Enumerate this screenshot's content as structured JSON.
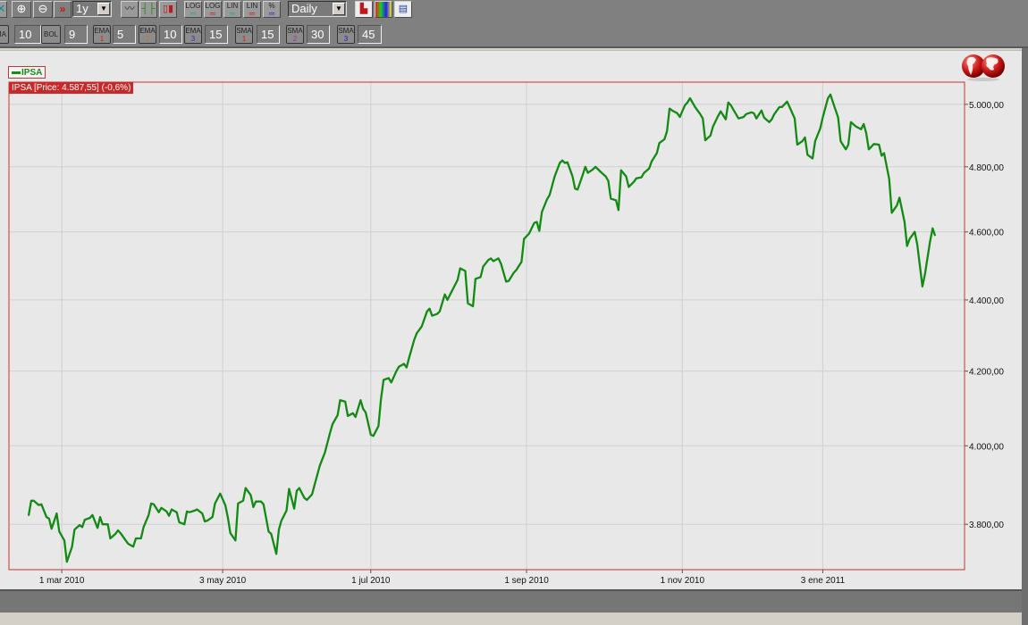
{
  "toolbar": {
    "period_select": "1y",
    "interval_select": "Daily",
    "scale_buttons": [
      {
        "top": "LOG",
        "color": "#3aa36a"
      },
      {
        "top": "LOG",
        "color": "#d02020"
      },
      {
        "top": "LIN",
        "color": "#3aa36a"
      },
      {
        "top": "LIN",
        "color": "#d02020"
      },
      {
        "top": "%",
        "color": "#3030c0"
      }
    ],
    "icons": [
      "close-icon",
      "zoom-in-icon",
      "zoom-out-icon",
      "double-chevron-right-icon",
      "line-chart-icon",
      "ohlc-chart-icon",
      "candlestick-chart-icon",
      "chart-settings-icon",
      "color-palette-icon",
      "report-icon"
    ]
  },
  "indicators": [
    {
      "label": "MA",
      "sub": "",
      "sub_color": "",
      "value": "10"
    },
    {
      "label": "BOL",
      "sub": "",
      "sub_color": "",
      "value": "9"
    },
    {
      "label": "EMA",
      "sub": "1",
      "sub_color": "#d02020",
      "value": "5"
    },
    {
      "label": "EMA",
      "sub": "2",
      "sub_color": "#d07020",
      "value": "10"
    },
    {
      "label": "EMA",
      "sub": "3",
      "sub_color": "#3030c0",
      "value": "15"
    },
    {
      "label": "SMA",
      "sub": "1",
      "sub_color": "#d02020",
      "value": "15"
    },
    {
      "label": "SMA",
      "sub": "2",
      "sub_color": "#a030a0",
      "value": "30"
    },
    {
      "label": "SMA",
      "sub": "3",
      "sub_color": "#2020c0",
      "value": "45"
    }
  ],
  "legend": {
    "label": "IPSA",
    "color": "#1a8a1a"
  },
  "price_tag": "IPSA [Price: 4.587,55] (-0,6%)",
  "colors": {
    "line": "#138a13",
    "frame": "#c83030",
    "grid": "#d0d0d0",
    "panel": "#e8e8e8"
  },
  "chart_data": {
    "type": "line",
    "title": "IPSA",
    "yscale": "log",
    "ylim": [
      3689,
      5073
    ],
    "xlim": [
      -20.7,
      353.5
    ],
    "x_unit": "days from 1 mar 2010 (axis)",
    "y_ticks": [
      {
        "v": 3800,
        "label": "3.800,00"
      },
      {
        "v": 4000,
        "label": "4.000,00"
      },
      {
        "v": 4200,
        "label": "4.200,00"
      },
      {
        "v": 4400,
        "label": "4.400,00"
      },
      {
        "v": 4600,
        "label": "4.600,00"
      },
      {
        "v": 4800,
        "label": "4.800,00"
      },
      {
        "v": 5000,
        "label": "5.000,00"
      }
    ],
    "x_ticks": [
      {
        "v": 0,
        "label": "1 mar 2010"
      },
      {
        "v": 63,
        "label": "3 may 2010"
      },
      {
        "v": 121,
        "label": "1 jul 2010"
      },
      {
        "v": 182,
        "label": "1 sep 2010"
      },
      {
        "v": 243,
        "label": "1 nov 2010"
      },
      {
        "v": 298,
        "label": "3 ene 2011"
      }
    ],
    "grid": true,
    "series": [
      {
        "name": "IPSA",
        "x": [
          -13,
          -12,
          -11,
          -9,
          -8,
          -6,
          -5,
          -4,
          -2,
          -1,
          1,
          2,
          4,
          5,
          7,
          8,
          9,
          11,
          12,
          14,
          15,
          16,
          18,
          19,
          21,
          22,
          23,
          25,
          26,
          28,
          29,
          31,
          32,
          34,
          35,
          36,
          38,
          39,
          41,
          42,
          43,
          45,
          46,
          48,
          49,
          50,
          52,
          53,
          55,
          56,
          57,
          59,
          60,
          62,
          64,
          65,
          66,
          68,
          69,
          71,
          72,
          74,
          75,
          76,
          78,
          79,
          81,
          82,
          84,
          85,
          86,
          88,
          89,
          91,
          92,
          93,
          95,
          96,
          98,
          99,
          101,
          103,
          105,
          106,
          108,
          109,
          111,
          112,
          114,
          115,
          117,
          118,
          119,
          121,
          122,
          124,
          125,
          126,
          128,
          129,
          131,
          132,
          134,
          135,
          136,
          138,
          139,
          141,
          143,
          144,
          145,
          147,
          148,
          150,
          151,
          153,
          155,
          156,
          158,
          159,
          161,
          162,
          164,
          165,
          167,
          168,
          169,
          171,
          172,
          174,
          175,
          177,
          178,
          180,
          181,
          183,
          185,
          186,
          187,
          188,
          190,
          191,
          193,
          195,
          196,
          197,
          198,
          200,
          201,
          202,
          204,
          205,
          206,
          208,
          209,
          211,
          213,
          214,
          215,
          217,
          218,
          219,
          221,
          222,
          224,
          225,
          227,
          228,
          230,
          231,
          233,
          234,
          236,
          237,
          238,
          239,
          241,
          242,
          244,
          245,
          246,
          248,
          250,
          251,
          252,
          254,
          255,
          257,
          258,
          260,
          261,
          262,
          264,
          265,
          267,
          268,
          270,
          271,
          272,
          274,
          275,
          277,
          278,
          279,
          281,
          282,
          284,
          285,
          287,
          288,
          290,
          291,
          292,
          294,
          295,
          297,
          298,
          300,
          301,
          302,
          304,
          305,
          307,
          308,
          309,
          311,
          313,
          314,
          315,
          316,
          318,
          320,
          321,
          322,
          324,
          325,
          327,
          328,
          330,
          331,
          332,
          334,
          335,
          337,
          338,
          340,
          341,
          342
        ],
        "values": [
          3821,
          3859,
          3859,
          3848,
          3850,
          3818,
          3814,
          3789,
          3827,
          3782,
          3760,
          3708,
          3745,
          3787,
          3798,
          3793,
          3811,
          3816,
          3823,
          3791,
          3818,
          3800,
          3800,
          3765,
          3776,
          3785,
          3778,
          3760,
          3752,
          3745,
          3765,
          3765,
          3793,
          3823,
          3852,
          3850,
          3830,
          3841,
          3832,
          3821,
          3837,
          3830,
          3805,
          3800,
          3832,
          3830,
          3834,
          3837,
          3827,
          3807,
          3809,
          3818,
          3852,
          3877,
          3848,
          3818,
          3778,
          3760,
          3852,
          3859,
          3891,
          3873,
          3843,
          3857,
          3857,
          3850,
          3782,
          3776,
          3727,
          3787,
          3809,
          3834,
          3889,
          3839,
          3884,
          3891,
          3866,
          3861,
          3875,
          3900,
          3948,
          3982,
          4033,
          4057,
          4081,
          4121,
          4117,
          4079,
          4086,
          4076,
          4121,
          4098,
          4088,
          4029,
          4026,
          4052,
          4124,
          4176,
          4181,
          4169,
          4200,
          4212,
          4220,
          4210,
          4237,
          4287,
          4305,
          4325,
          4367,
          4375,
          4355,
          4360,
          4367,
          4416,
          4400,
          4429,
          4458,
          4492,
          4484,
          4390,
          4382,
          4461,
          4466,
          4497,
          4516,
          4521,
          4513,
          4521,
          4505,
          4453,
          4455,
          4479,
          4487,
          4511,
          4579,
          4595,
          4627,
          4630,
          4603,
          4660,
          4699,
          4712,
          4770,
          4812,
          4820,
          4812,
          4814,
          4770,
          4732,
          4729,
          4775,
          4800,
          4781,
          4792,
          4800,
          4784,
          4770,
          4756,
          4701,
          4696,
          4666,
          4789,
          4770,
          4737,
          4753,
          4764,
          4767,
          4781,
          4795,
          4817,
          4843,
          4875,
          4887,
          4913,
          4986,
          4980,
          4971,
          4959,
          4997,
          5006,
          5020,
          4991,
          4968,
          4954,
          4884,
          4899,
          4928,
          4962,
          4977,
          4951,
          5006,
          4997,
          4968,
          4954,
          4959,
          4968,
          4974,
          4971,
          4954,
          4980,
          4957,
          4942,
          4951,
          4968,
          4991,
          4991,
          5009,
          4991,
          4954,
          4870,
          4881,
          4893,
          4838,
          4826,
          4881,
          4922,
          4957,
          5020,
          5032,
          5006,
          4957,
          4881,
          4855,
          4870,
          4942,
          4928,
          4919,
          4936,
          4907,
          4855,
          4872,
          4870,
          4835,
          4843,
          4762,
          4658,
          4680,
          4704,
          4630,
          4558,
          4579,
          4600,
          4563,
          4439,
          4474,
          4571,
          4611,
          4588
        ]
      }
    ]
  }
}
